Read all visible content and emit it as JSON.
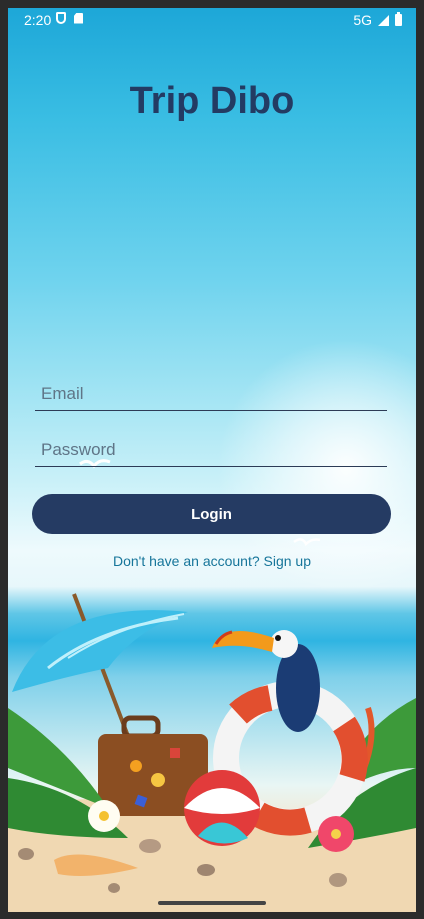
{
  "status": {
    "time": "2:20",
    "network": "5G",
    "icons": [
      "shield-icon",
      "sd-card-icon",
      "signal-icon",
      "battery-icon"
    ]
  },
  "app": {
    "title": "Trip Dibo"
  },
  "form": {
    "email_placeholder": "Email",
    "password_placeholder": "Password",
    "login_label": "Login",
    "signup_link": "Don't have an account? Sign up"
  },
  "colors": {
    "primary": "#253b63",
    "title": "#233b63",
    "link": "#16759a"
  }
}
